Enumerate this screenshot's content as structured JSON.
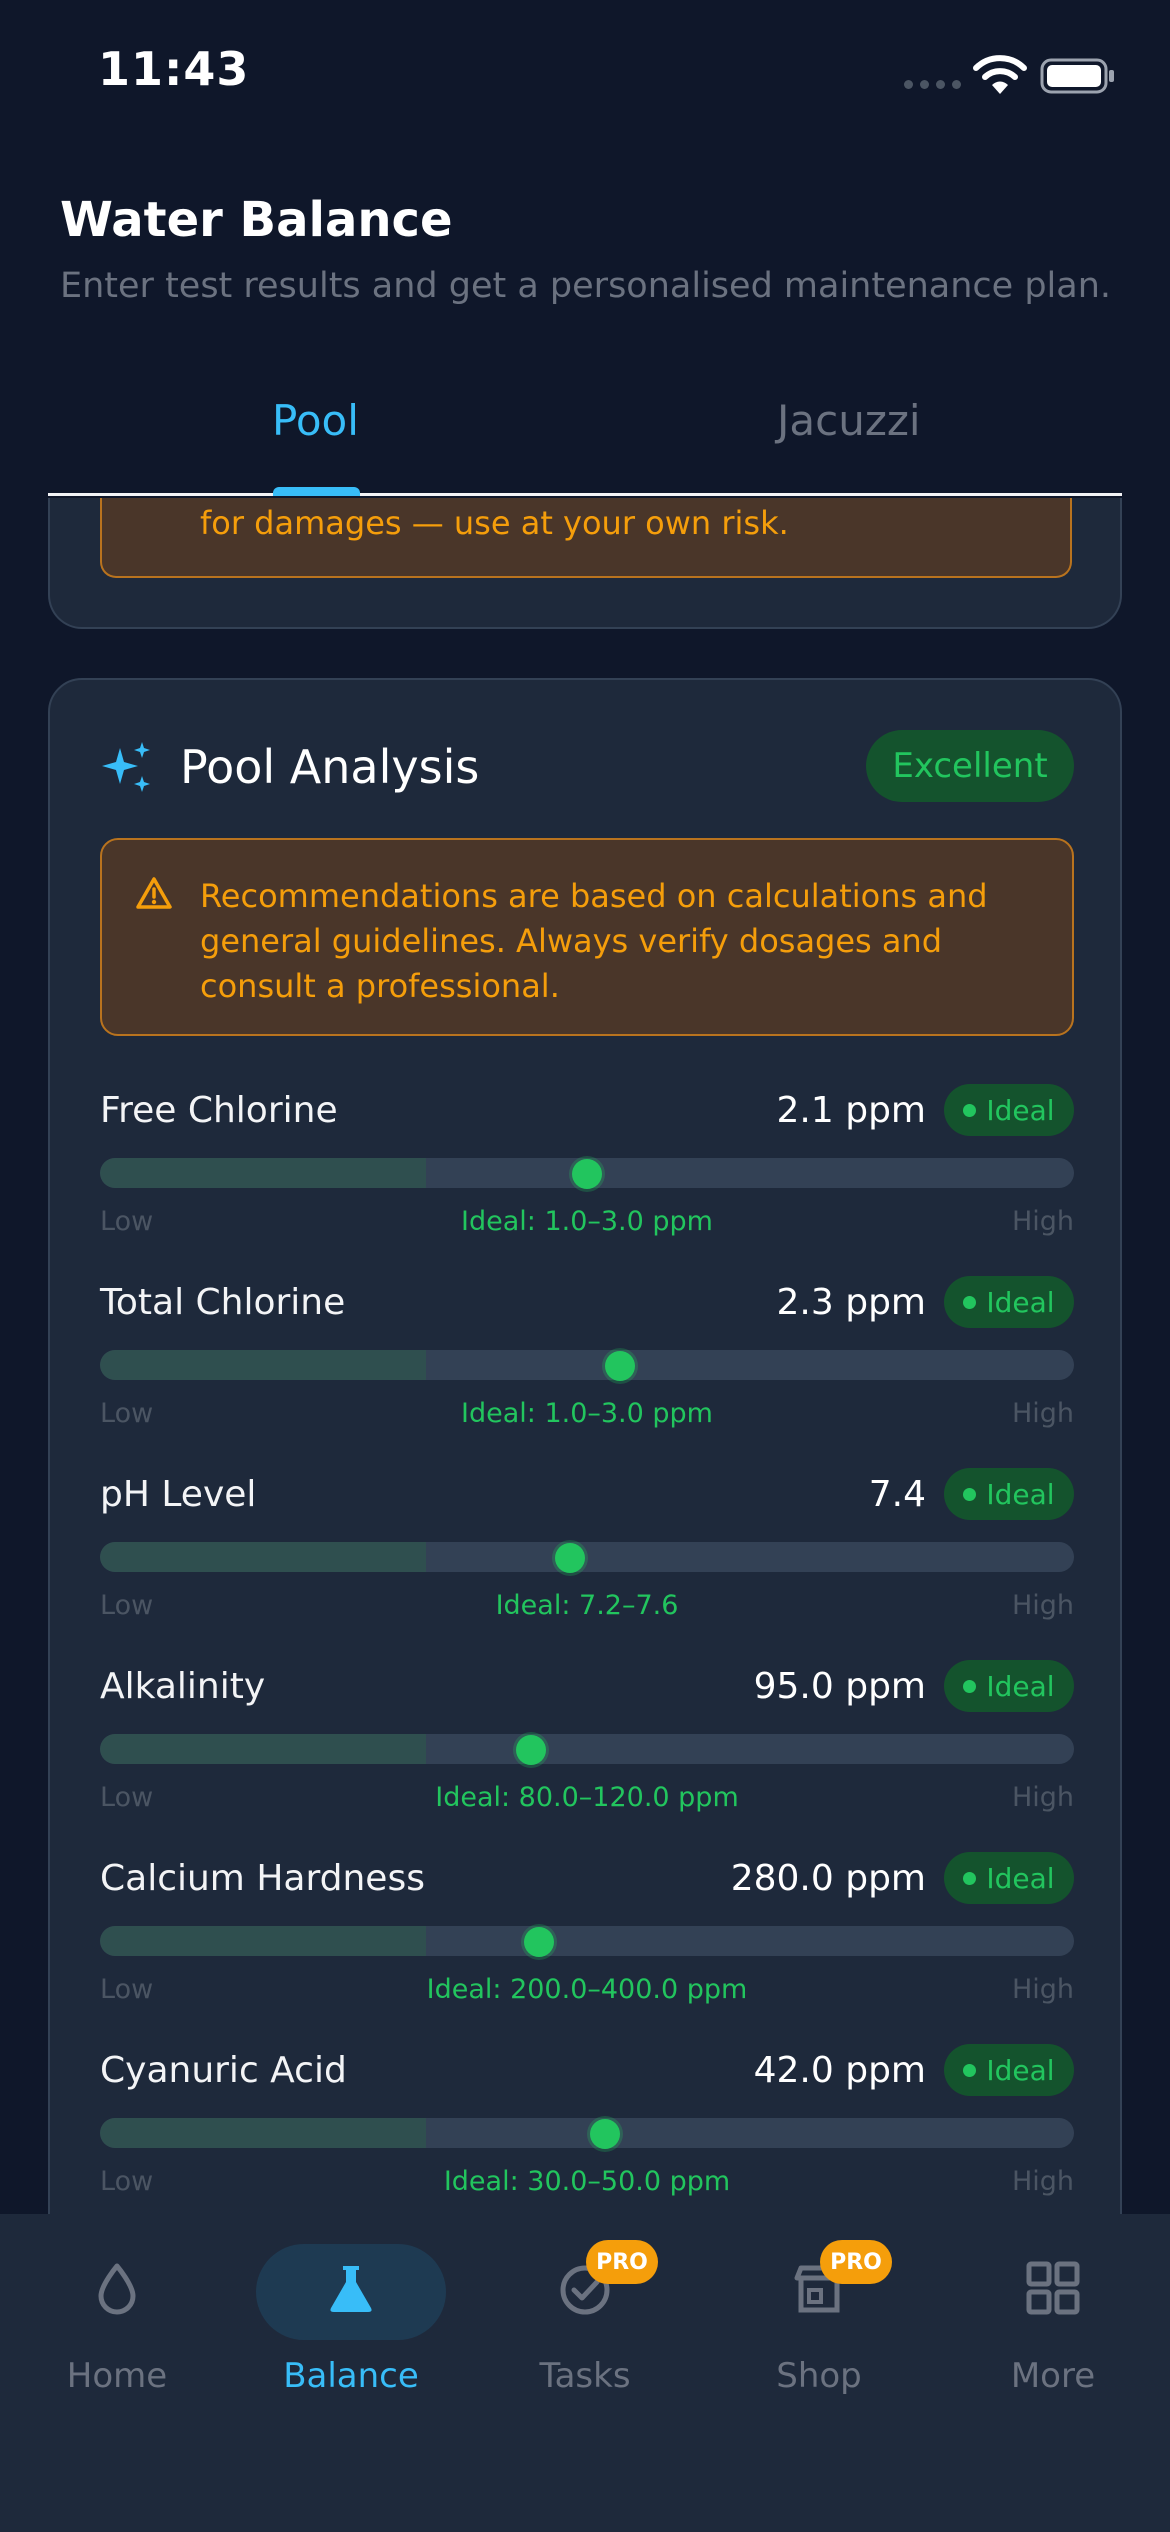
{
  "status_bar": {
    "time": "11:43"
  },
  "header": {
    "title": "Water Balance",
    "subtitle": "Enter test results and get a personalised maintenance plan."
  },
  "tabs": [
    {
      "label": "Pool",
      "active": true
    },
    {
      "label": "Jacuzzi",
      "active": false
    }
  ],
  "disclaimer": {
    "tail_text": "for damages — use at your own risk."
  },
  "analysis": {
    "title": "Pool Analysis",
    "status": "Excellent",
    "warning": "Recommendations are based on calculations and general guidelines. Always verify dosages and consult a professional.",
    "low_label": "Low",
    "high_label": "High",
    "badge_label": "Ideal",
    "metrics": [
      {
        "name": "Free Chlorine",
        "value": "2.1 ppm",
        "status": "Ideal",
        "ideal_range": "Ideal: 1.0–3.0 ppm",
        "position": 0.5
      },
      {
        "name": "Total Chlorine",
        "value": "2.3 ppm",
        "status": "Ideal",
        "ideal_range": "Ideal: 1.0–3.0 ppm",
        "position": 0.534
      },
      {
        "name": "pH Level",
        "value": "7.4",
        "status": "Ideal",
        "ideal_range": "Ideal: 7.2–7.6",
        "position": 0.483
      },
      {
        "name": "Alkalinity",
        "value": "95.0 ppm",
        "status": "Ideal",
        "ideal_range": "Ideal: 80.0–120.0 ppm",
        "position": 0.442
      },
      {
        "name": "Calcium Hardness",
        "value": "280.0 ppm",
        "status": "Ideal",
        "ideal_range": "Ideal: 200.0–400.0 ppm",
        "position": 0.451
      },
      {
        "name": "Cyanuric Acid",
        "value": "42.0 ppm",
        "status": "Ideal",
        "ideal_range": "Ideal: 30.0–50.0 ppm",
        "position": 0.518
      }
    ]
  },
  "bottom_nav": {
    "pro_label": "PRO",
    "items": [
      {
        "label": "Home",
        "icon": "drop-icon",
        "active": false,
        "pro": false
      },
      {
        "label": "Balance",
        "icon": "flask-icon",
        "active": true,
        "pro": false
      },
      {
        "label": "Tasks",
        "icon": "check-circle-icon",
        "active": false,
        "pro": true
      },
      {
        "label": "Shop",
        "icon": "store-icon",
        "active": false,
        "pro": true
      },
      {
        "label": "More",
        "icon": "grid-icon",
        "active": false,
        "pro": false
      }
    ]
  },
  "colors": {
    "background": "#0f172a",
    "card": "#1e293b",
    "accent": "#38bdf8",
    "ideal_green": "#22c55e",
    "warning_amber": "#f59e0b"
  }
}
